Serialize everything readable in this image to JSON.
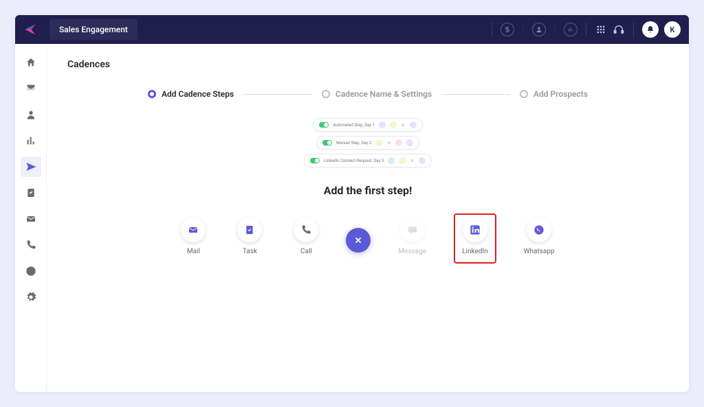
{
  "header": {
    "module": "Sales Engagement",
    "user_initial": "K"
  },
  "page": {
    "title": "Cadences",
    "prompt": "Add the first step!"
  },
  "stepper": {
    "steps": [
      {
        "label": "Add Cadence Steps",
        "active": true
      },
      {
        "label": "Cadence Name & Settings",
        "active": false
      },
      {
        "label": "Add Prospects",
        "active": false
      }
    ]
  },
  "illustration": {
    "rows": [
      "Automated Step, Day 1",
      "Manual Step, Day 2",
      "LinkedIn Connect Request, Day 3"
    ]
  },
  "options": [
    {
      "id": "mail",
      "label": "Mail"
    },
    {
      "id": "task",
      "label": "Task"
    },
    {
      "id": "call",
      "label": "Call"
    },
    {
      "id": "message",
      "label": "Message",
      "disabled": true
    },
    {
      "id": "linkedin",
      "label": "LinkedIn",
      "highlighted": true
    },
    {
      "id": "whatsapp",
      "label": "Whatsapp"
    }
  ],
  "colors": {
    "primary": "#5b5ad6",
    "topbar": "#1f1e4c",
    "highlight_border": "#e02020",
    "mail_icon": "#5b5ad6",
    "task_icon": "#5b5ad6",
    "call_icon": "#6b6b6b",
    "message_icon": "#b8b8b8",
    "linkedin_icon": "#5b5ad6",
    "whatsapp_icon": "#6b5ad6"
  }
}
